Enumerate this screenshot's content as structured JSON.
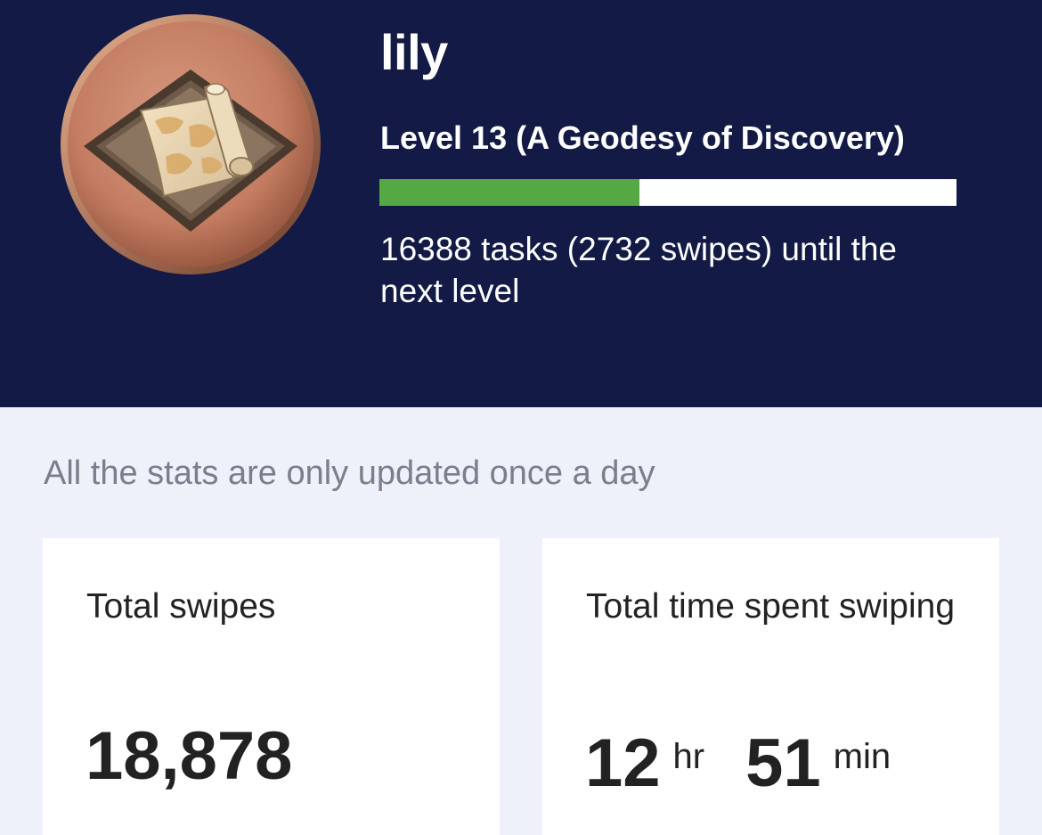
{
  "profile": {
    "username": "lily",
    "level_title": "Level 13 (A Geodesy of Discovery)",
    "progress_fraction": 0.45,
    "next_level_text": "16388 tasks (2732 swipes) until the next level",
    "badge_icon": "map-scroll-icon"
  },
  "notice": "All the stats are only updated once a day",
  "stats": {
    "total_swipes": {
      "label": "Total swipes",
      "value": "18,878"
    },
    "total_time": {
      "label": "Total time spent swiping",
      "hours": "12",
      "hours_unit": "hr",
      "minutes": "51",
      "minutes_unit": "min"
    }
  },
  "colors": {
    "header_bg": "#121a45",
    "page_bg": "#eef1f9",
    "progress_fill": "#56a844",
    "progress_track": "#ffffff"
  }
}
